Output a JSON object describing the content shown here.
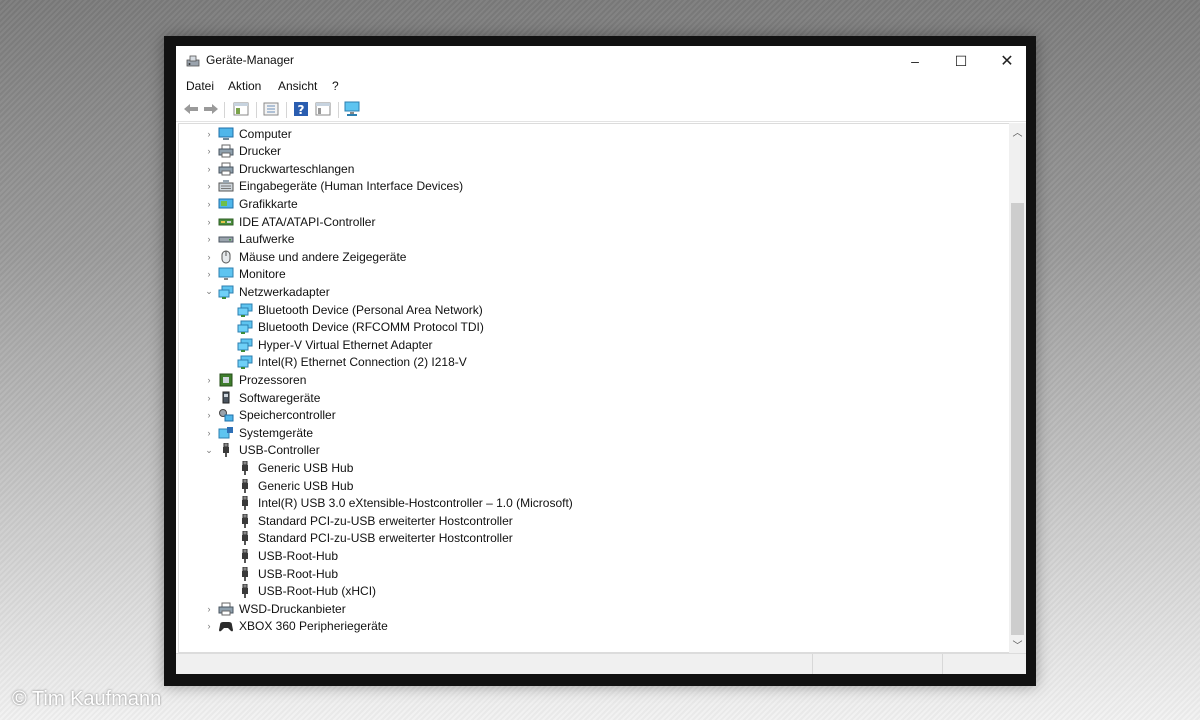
{
  "window": {
    "title": "Geräte-Manager",
    "icon": "device-manager-icon",
    "controls": {
      "minimize": "–",
      "maximize": "☐",
      "close": "✕"
    }
  },
  "menu": {
    "items": [
      "Datei",
      "Aktion",
      "Ansicht",
      "?"
    ]
  },
  "toolbar": {
    "buttons": [
      "back-arrow-icon",
      "forward-arrow-icon",
      "properties-view-icon",
      "console-tree-icon",
      "help-icon",
      "list-view-icon",
      "computer-monitor-icon"
    ]
  },
  "tree": {
    "categories": [
      {
        "label": "Computer",
        "icon": "computer-icon",
        "expanded": false
      },
      {
        "label": "Drucker",
        "icon": "printer-icon",
        "expanded": false
      },
      {
        "label": "Druckwarteschlangen",
        "icon": "print-queue-icon",
        "expanded": false
      },
      {
        "label": "Eingabegeräte (Human Interface Devices)",
        "icon": "keyboard-icon",
        "expanded": false
      },
      {
        "label": "Grafikkarte",
        "icon": "display-adapter-icon",
        "expanded": false
      },
      {
        "label": "IDE ATA/ATAPI-Controller",
        "icon": "ide-controller-icon",
        "expanded": false
      },
      {
        "label": "Laufwerke",
        "icon": "disk-drive-icon",
        "expanded": false
      },
      {
        "label": "Mäuse und andere Zeigegeräte",
        "icon": "mouse-icon",
        "expanded": false
      },
      {
        "label": "Monitore",
        "icon": "monitor-icon",
        "expanded": false
      },
      {
        "label": "Netzwerkadapter",
        "icon": "network-adapter-icon",
        "expanded": true,
        "children": [
          "Bluetooth Device (Personal Area Network)",
          "Bluetooth Device (RFCOMM Protocol TDI)",
          "Hyper-V Virtual Ethernet Adapter",
          "Intel(R) Ethernet Connection (2) I218-V"
        ]
      },
      {
        "label": "Prozessoren",
        "icon": "processor-icon",
        "expanded": false
      },
      {
        "label": "Softwaregeräte",
        "icon": "software-device-icon",
        "expanded": false
      },
      {
        "label": "Speichercontroller",
        "icon": "storage-controller-icon",
        "expanded": false
      },
      {
        "label": "Systemgeräte",
        "icon": "system-device-icon",
        "expanded": false
      },
      {
        "label": "USB-Controller",
        "icon": "usb-plug-icon",
        "expanded": true,
        "children": [
          "Generic USB Hub",
          "Generic USB Hub",
          "Intel(R) USB 3.0 eXtensible-Hostcontroller – 1.0 (Microsoft)",
          "Standard PCI-zu-USB erweiterter Hostcontroller",
          "Standard PCI-zu-USB erweiterter Hostcontroller",
          "USB-Root-Hub",
          "USB-Root-Hub",
          "USB-Root-Hub (xHCI)"
        ]
      },
      {
        "label": "WSD-Druckanbieter",
        "icon": "wsd-printer-icon",
        "expanded": false
      },
      {
        "label": "XBOX 360 Peripheriegeräte",
        "icon": "gamepad-icon",
        "expanded": false
      }
    ]
  },
  "credit": "© Tim Kaufmann"
}
